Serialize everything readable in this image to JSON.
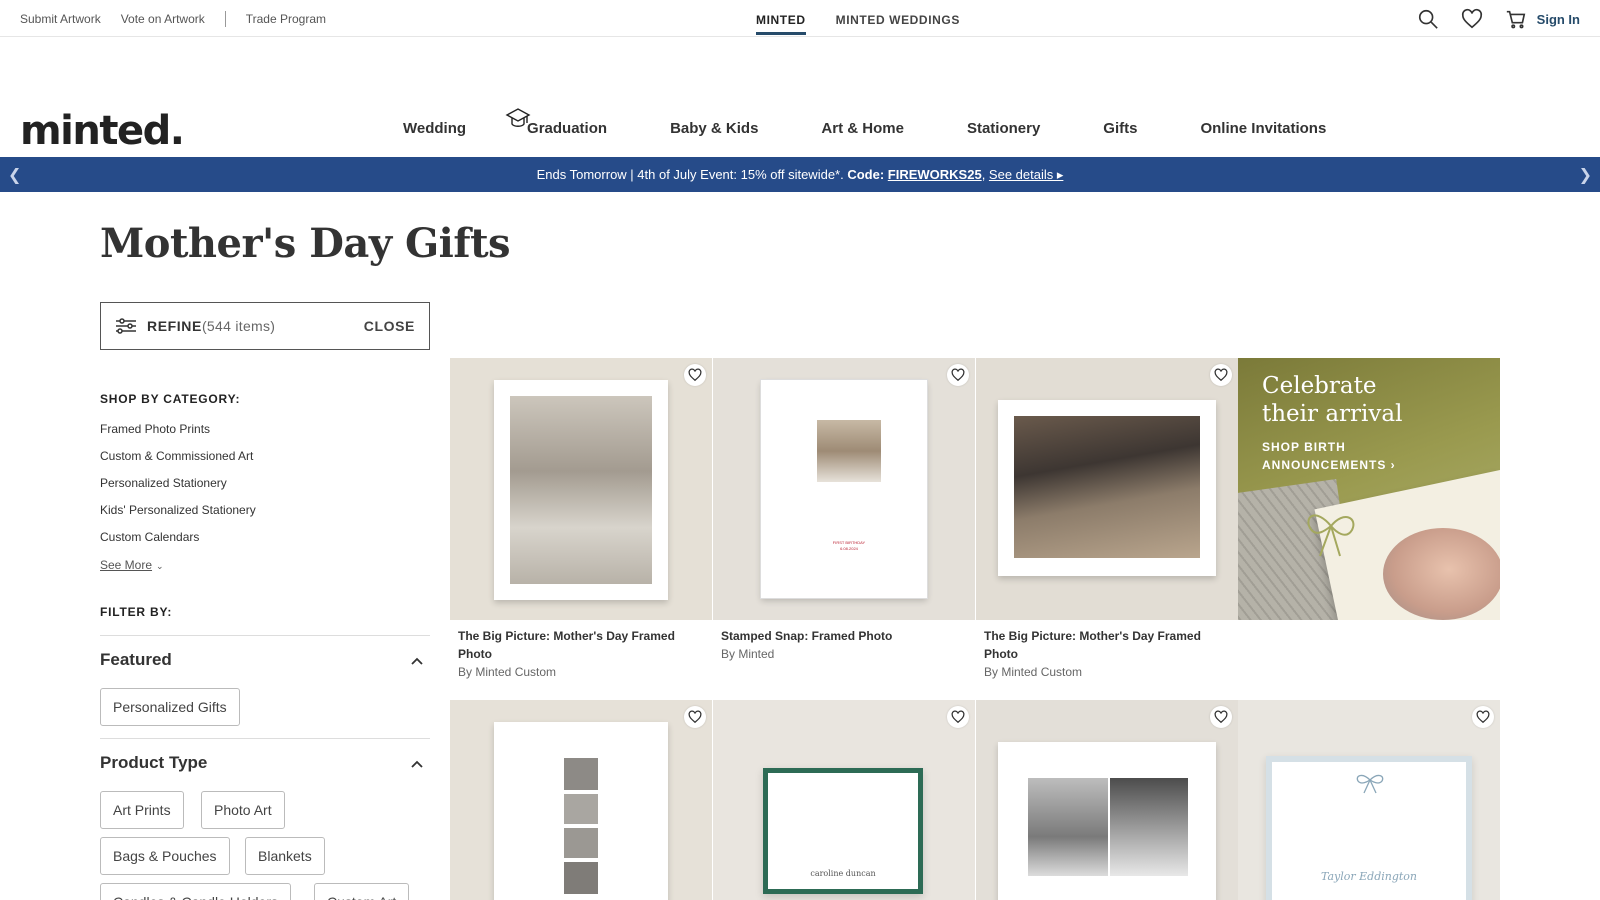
{
  "util_bar": {
    "links": [
      "Submit Artwork",
      "Vote on Artwork",
      "Trade Program"
    ],
    "tabs": [
      "MINTED",
      "MINTED WEDDINGS"
    ],
    "sign_in": "Sign In"
  },
  "logo": "minted.",
  "nav": [
    "Wedding",
    "Graduation",
    "Baby & Kids",
    "Art & Home",
    "Stationery",
    "Gifts",
    "Online Invitations"
  ],
  "promo": {
    "message": "Ends Tomorrow | 4th of July Event: 15% off sitewide*. ",
    "code_label": "Code: ",
    "code": "FIREWORKS25",
    "details": "See details ▸"
  },
  "page_title": "Mother's Day Gifts",
  "refine": {
    "label": "REFINE",
    "count": "(544 items)",
    "close": "CLOSE"
  },
  "shop_by": {
    "heading": "SHOP BY CATEGORY:",
    "items": [
      "Framed Photo Prints",
      "Custom & Commissioned Art",
      "Personalized Stationery",
      "Kids' Personalized Stationery",
      "Custom Calendars"
    ],
    "see_more": "See More"
  },
  "filter_by": {
    "heading": "FILTER BY:",
    "featured": {
      "title": "Featured",
      "chips": [
        "Personalized Gifts"
      ]
    },
    "product_type": {
      "title": "Product Type",
      "chips": [
        "Art Prints",
        "Photo Art",
        "Bags & Pouches",
        "Blankets",
        "Candles & Candle Holders",
        "Custom Art"
      ]
    }
  },
  "products": [
    {
      "title": "The Big Picture: Mother's Day Framed Photo",
      "by": "By Minted Custom"
    },
    {
      "title": "Stamped Snap: Framed Photo",
      "by": "By Minted"
    },
    {
      "title": "The Big Picture: Mother's Day Framed Photo",
      "by": "By Minted Custom"
    }
  ],
  "promo_tile": {
    "title_line1": "Celebrate",
    "title_line2": "their arrival",
    "cta_line1": "SHOP BIRTH",
    "cta_line2": "ANNOUNCEMENTS ›"
  },
  "card_text": {
    "stamped": "FIRST BIRTHDAY",
    "stamped_date": "6.08.2024",
    "stationery1": "caroline duncan",
    "stationery2": "Taylor Eddington"
  },
  "colors": {
    "banner": "#264b89",
    "accent": "#264b6a"
  }
}
